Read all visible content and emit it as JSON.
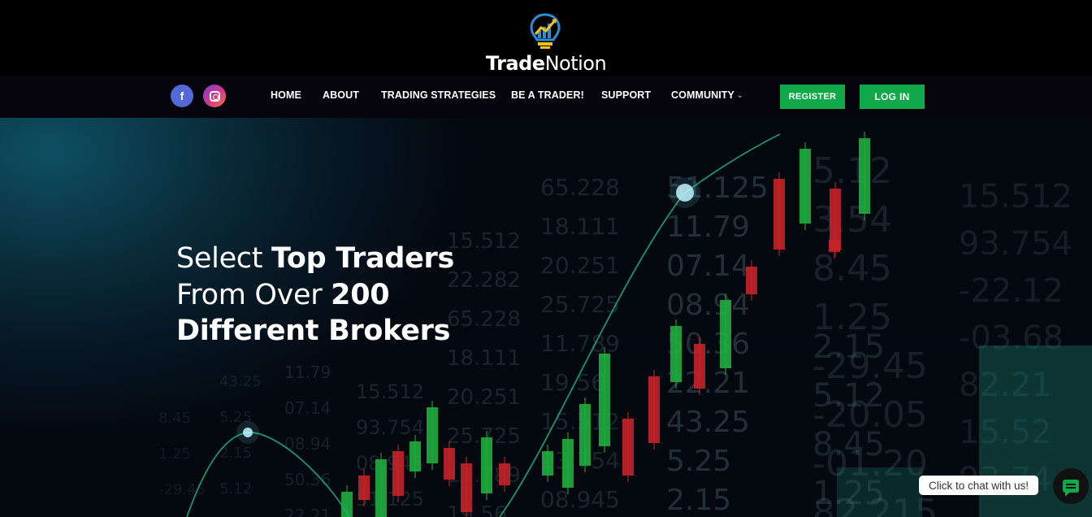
{
  "brand": {
    "name_bold": "Trade",
    "name_light": "Notion",
    "logo_icon": "lightbulb-chart-icon"
  },
  "social": [
    {
      "name": "facebook",
      "icon": "facebook-icon",
      "color": "#5468d8"
    },
    {
      "name": "instagram",
      "icon": "instagram-icon",
      "color": "#d43a86"
    }
  ],
  "nav": {
    "items": [
      {
        "label": "HOME"
      },
      {
        "label": "ABOUT"
      },
      {
        "label": "TRADING STRATEGIES"
      },
      {
        "label": "BE A TRADER!"
      },
      {
        "label": "SUPPORT"
      },
      {
        "label": "COMMUNITY",
        "has_dropdown": true
      }
    ],
    "register_label": "REGISTER",
    "login_label": "LOG IN",
    "button_color": "#0fa94a"
  },
  "hero": {
    "line1_light": "Select ",
    "line1_bold": "Top Traders",
    "line2_light": "From Over ",
    "line2_bold": "200",
    "line3_bold": "Different Brokers"
  },
  "chat": {
    "bubble_text": "Click to chat with us!",
    "icon": "chat-icon"
  },
  "background_numbers": [
    "65.228",
    "18.111",
    "20.251",
    "25.725",
    "11.789",
    "19.56",
    "15.512",
    "93.754",
    "08.945",
    "51.125",
    "11.79",
    "07.14",
    "08.94",
    "50.36",
    "22.21",
    "43.25",
    "5.25",
    "2.15",
    "5.12",
    "3.54",
    "8.45",
    "1.25",
    "-29.45",
    "-20.05",
    "-01.20",
    "82.215",
    "15.512",
    "93.754",
    "-22.12",
    "-03.68",
    "82.21",
    "15.52",
    "93.74",
    "2.15",
    "5.12",
    "8.45",
    "1.25",
    "15.512",
    "22.282"
  ]
}
